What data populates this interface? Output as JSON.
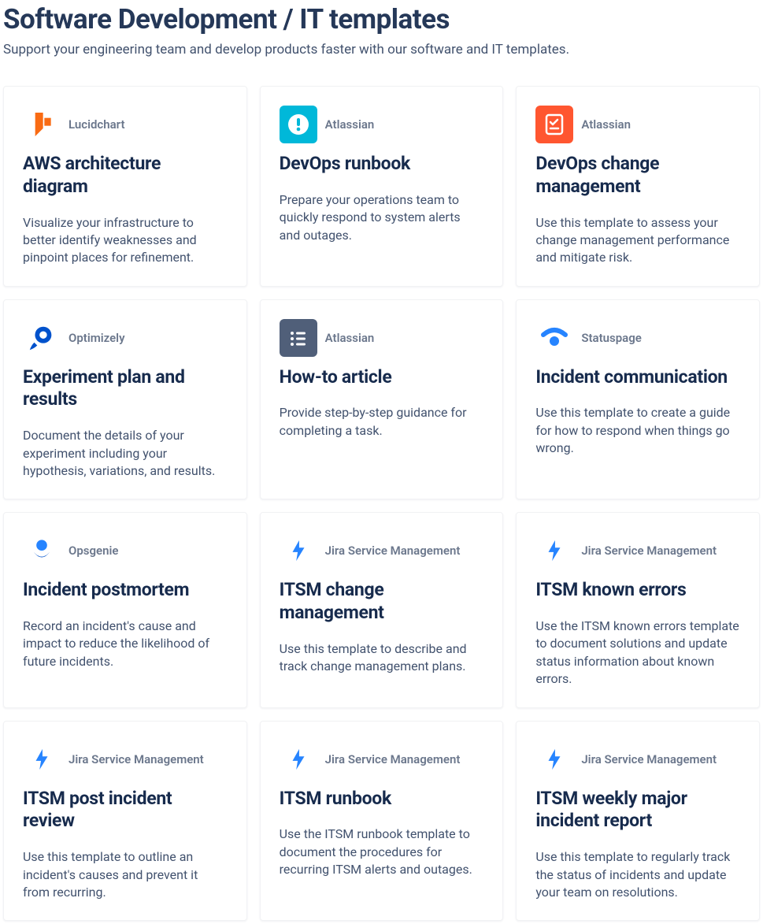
{
  "header": {
    "title": "Software Development / IT templates",
    "subtitle": "Support your engineering team and develop products faster with our software and IT templates."
  },
  "cards": [
    {
      "icon": "lucidchart",
      "vendor": "Lucidchart",
      "title": "AWS architecture diagram",
      "desc": "Visualize your infrastructure to better identify weaknesses and pinpoint places for refinement."
    },
    {
      "icon": "exclaim",
      "vendor": "Atlassian",
      "title": "DevOps runbook",
      "desc": "Prepare your operations team to quickly respond to system alerts and outages."
    },
    {
      "icon": "checklist-red",
      "vendor": "Atlassian",
      "title": "DevOps change management",
      "desc": "Use this template to assess your change management performance and mitigate risk."
    },
    {
      "icon": "optimizely",
      "vendor": "Optimizely",
      "title": "Experiment plan and results",
      "desc": "Document the details of your experiment including your hypothesis, variations, and results."
    },
    {
      "icon": "list-gray",
      "vendor": "Atlassian",
      "title": "How-to article",
      "desc": "Provide step-by-step guidance for completing a task."
    },
    {
      "icon": "statuspage",
      "vendor": "Statuspage",
      "title": "Incident communication",
      "desc": "Use this template to create a guide for how to respond when things go wrong."
    },
    {
      "icon": "opsgenie",
      "vendor": "Opsgenie",
      "title": "Incident postmortem",
      "desc": "Record an incident's cause and impact to reduce the likelihood of future incidents."
    },
    {
      "icon": "jsm",
      "vendor": "Jira Service Management",
      "title": "ITSM change management",
      "desc": "Use this template to describe and track change management plans."
    },
    {
      "icon": "jsm",
      "vendor": "Jira Service Management",
      "title": "ITSM known errors",
      "desc": "Use the ITSM known errors template to document solutions and update status information about known errors."
    },
    {
      "icon": "jsm",
      "vendor": "Jira Service Management",
      "title": "ITSM post incident review",
      "desc": "Use this template to outline an incident's causes and prevent it from recurring."
    },
    {
      "icon": "jsm",
      "vendor": "Jira Service Management",
      "title": "ITSM runbook",
      "desc": "Use the ITSM runbook template to document the procedures for recurring ITSM alerts and outages."
    },
    {
      "icon": "jsm",
      "vendor": "Jira Service Management",
      "title": "ITSM weekly major incident report",
      "desc": "Use this template to regularly track the status of incidents and update your team on resolutions."
    }
  ]
}
